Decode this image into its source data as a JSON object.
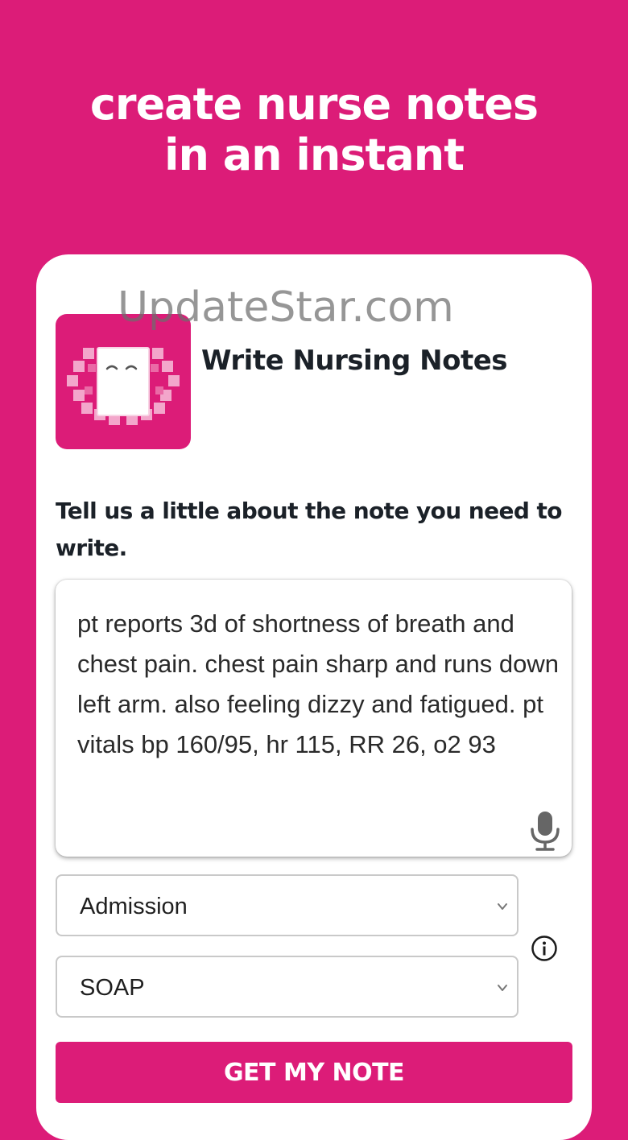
{
  "headline": {
    "line1": "create nurse notes",
    "line2": "in an instant"
  },
  "app": {
    "title": "Write Nursing Notes",
    "icon": "smiling-notepad-icon"
  },
  "prompt": "Tell us a little about the note you need to write.",
  "watermark": "UpdateStar.com",
  "note": {
    "text": "pt reports 3d of shortness of breath and chest pain. chest pain sharp and runs down left arm. also feeling dizzy and fatigued. pt vitals bp 160/95, hr 115, RR 26, o2 93",
    "mic_icon": "microphone-icon"
  },
  "selects": {
    "note_type": "Admission",
    "format": "SOAP"
  },
  "info_icon": "info-icon",
  "cta_label": "GET MY NOTE",
  "colors": {
    "brand": "#dc1c78",
    "card": "#ffffff",
    "text": "#1b2128"
  }
}
